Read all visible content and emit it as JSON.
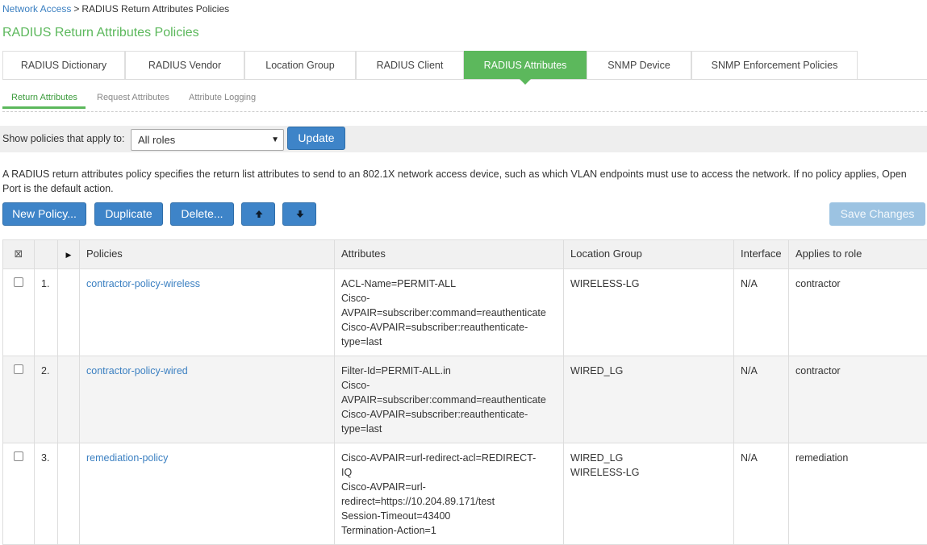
{
  "breadcrumb": {
    "link": "Network Access",
    "separator": ">",
    "current": "RADIUS Return Attributes Policies"
  },
  "page_title": "RADIUS Return Attributes Policies",
  "tabs": [
    {
      "label": "RADIUS Dictionary"
    },
    {
      "label": "RADIUS Vendor"
    },
    {
      "label": "Location Group"
    },
    {
      "label": "RADIUS Client"
    },
    {
      "label": "RADIUS Attributes",
      "active": true
    },
    {
      "label": "SNMP Device"
    },
    {
      "label": "SNMP Enforcement Policies"
    }
  ],
  "subtabs": [
    {
      "label": "Return Attributes",
      "active": true
    },
    {
      "label": "Request Attributes"
    },
    {
      "label": "Attribute Logging"
    }
  ],
  "filter": {
    "label": "Show policies that apply to:",
    "selected": "All roles",
    "update_label": "Update"
  },
  "description": "A RADIUS return attributes policy specifies the return list attributes to send to an 802.1X network access device, such as which VLAN endpoints must use to access the network. If no policy applies, Open Port is the default action.",
  "toolbar": {
    "new_policy": "New Policy...",
    "duplicate": "Duplicate",
    "delete": "Delete...",
    "move_up_icon": "arrow-up-icon",
    "move_down_icon": "arrow-down-icon",
    "save_changes": "Save Changes"
  },
  "table": {
    "columns": [
      "Policies",
      "Attributes",
      "Location Group",
      "Interface",
      "Applies to role"
    ],
    "rows": [
      {
        "index": "1.",
        "policy": "contractor-policy-wireless",
        "attributes": [
          "ACL-Name=PERMIT-ALL",
          "Cisco-",
          "AVPAIR=subscriber:command=reauthenticate",
          "Cisco-AVPAIR=subscriber:reauthenticate-",
          "type=last"
        ],
        "location_group": [
          "WIRELESS-LG"
        ],
        "interface": "N/A",
        "role": "contractor"
      },
      {
        "index": "2.",
        "policy": "contractor-policy-wired",
        "attributes": [
          "Filter-Id=PERMIT-ALL.in",
          "Cisco-",
          "AVPAIR=subscriber:command=reauthenticate",
          "Cisco-AVPAIR=subscriber:reauthenticate-",
          "type=last"
        ],
        "location_group": [
          "WIRED_LG"
        ],
        "interface": "N/A",
        "role": "contractor"
      },
      {
        "index": "3.",
        "policy": "remediation-policy",
        "attributes": [
          "Cisco-AVPAIR=url-redirect-acl=REDIRECT-",
          "IQ",
          "Cisco-AVPAIR=url-",
          "redirect=https://10.204.89.171/test",
          "Session-Timeout=43400",
          "Termination-Action=1"
        ],
        "location_group": [
          "WIRED_LG",
          "WIRELESS-LG"
        ],
        "interface": "N/A",
        "role": "remediation"
      }
    ]
  },
  "colors": {
    "accent_green": "#5cb85c",
    "button_blue": "#3e84c8",
    "link_blue": "#3a7fc1"
  }
}
